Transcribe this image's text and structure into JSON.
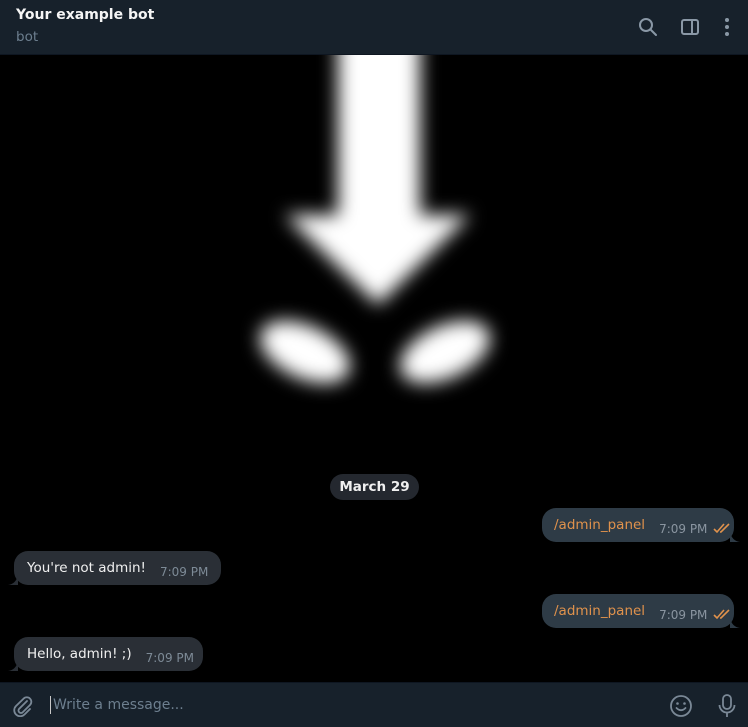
{
  "header": {
    "title": "Your example bot",
    "subtitle": "bot",
    "icons": [
      "search-icon",
      "sidebar-toggle-icon",
      "more-vertical-icon"
    ]
  },
  "chat": {
    "date_label": "March 29",
    "messages": [
      {
        "direction": "out",
        "text": "/admin_panel",
        "time": "7:09 PM",
        "status": "read"
      },
      {
        "direction": "in",
        "text": "You're not admin!",
        "time": "7:09 PM"
      },
      {
        "direction": "out",
        "text": "/admin_panel",
        "time": "7:09 PM",
        "status": "read"
      },
      {
        "direction": "in",
        "text": "Hello, admin! ;)",
        "time": "7:09 PM"
      }
    ]
  },
  "composer": {
    "placeholder": "Write a message...",
    "icons": [
      "attach-icon",
      "emoji-icon",
      "microphone-icon"
    ]
  },
  "colors": {
    "header_bg": "#17212b",
    "chat_bg": "#000000",
    "command_link": "#e0924c",
    "check_marks": "#e0924c"
  }
}
